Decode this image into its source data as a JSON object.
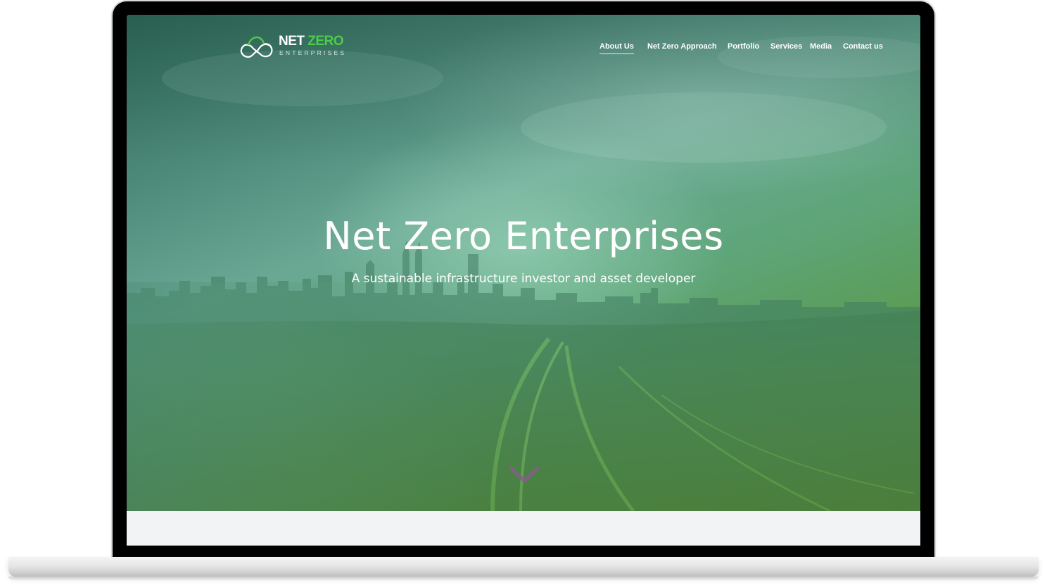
{
  "brand": {
    "name_part1": "NET",
    "name_part2": "ZERO",
    "subtitle": "ENTERPRISES",
    "accent_color": "#4ecb4a"
  },
  "nav": {
    "items": [
      {
        "label": "About Us",
        "active": true
      },
      {
        "label": "Net Zero Approach",
        "active": false
      },
      {
        "label": "Portfolio",
        "active": false
      },
      {
        "label": "Services",
        "active": false
      },
      {
        "label": "Media",
        "active": false
      },
      {
        "label": "Contact us",
        "active": false
      }
    ]
  },
  "hero": {
    "title": "Net Zero Enterprises",
    "subtitle": "A sustainable infrastructure investor and asset developer",
    "scroll_icon": "chevron-down-icon"
  },
  "colors": {
    "hero_tint": "#5ea57a",
    "lower_section_bg": "#f2f3f5"
  }
}
